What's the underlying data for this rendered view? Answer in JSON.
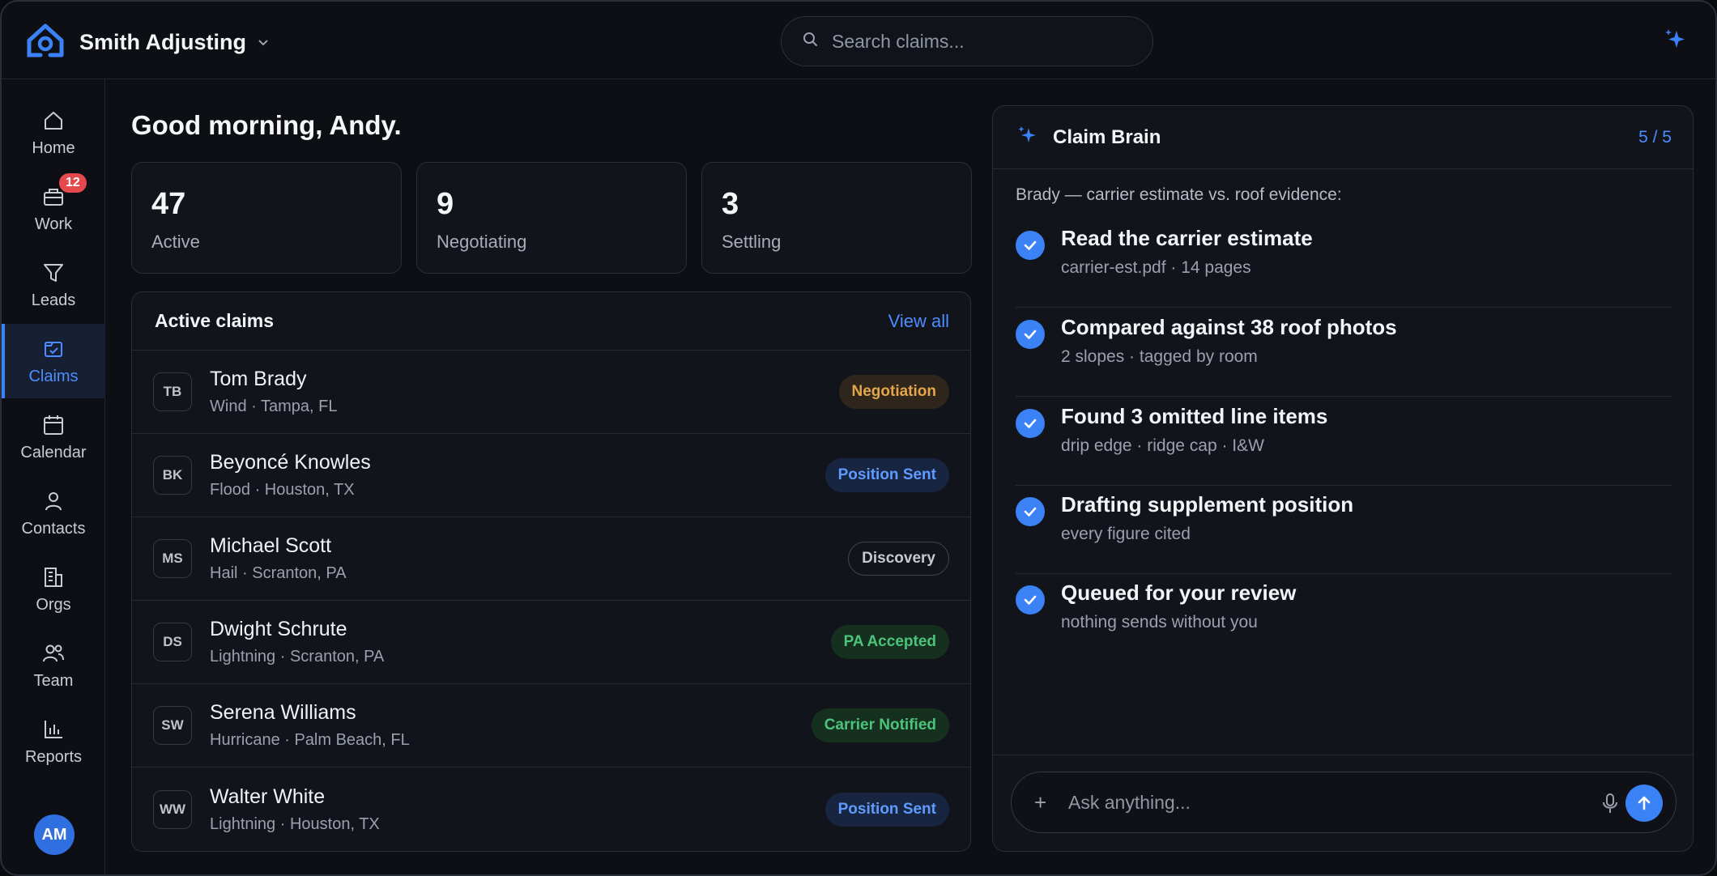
{
  "app": {
    "brand_name": "Smith Adjusting",
    "brand_chevron": "chevron-down-icon"
  },
  "search": {
    "placeholder": "Search claims..."
  },
  "sidebar": {
    "items": [
      {
        "label": "Home",
        "icon": "home-icon"
      },
      {
        "label": "Work",
        "icon": "inbox-icon",
        "badge": "12"
      },
      {
        "label": "Leads",
        "icon": "filter-icon"
      },
      {
        "label": "Claims",
        "icon": "claims-icon",
        "active": true
      },
      {
        "label": "Calendar",
        "icon": "calendar-icon"
      },
      {
        "label": "Contacts",
        "icon": "person-icon"
      },
      {
        "label": "Orgs",
        "icon": "building-icon"
      },
      {
        "label": "Team",
        "icon": "team-icon"
      },
      {
        "label": "Reports",
        "icon": "bar-chart-icon"
      }
    ],
    "avatar": "AM"
  },
  "main": {
    "greeting": "Good morning, Andy.",
    "stats": [
      {
        "value": "47",
        "label": "Active"
      },
      {
        "value": "9",
        "label": "Negotiating"
      },
      {
        "value": "3",
        "label": "Settling"
      }
    ],
    "claims": {
      "title": "Active claims",
      "view_all": "View all",
      "rows": [
        {
          "initials": "TB",
          "name": "Tom Brady",
          "sub": "Wind · Tampa, FL",
          "status": "Negotiation"
        },
        {
          "initials": "BK",
          "name": "Beyoncé Knowles",
          "sub": "Flood · Houston, TX",
          "status": "Position Sent"
        },
        {
          "initials": "MS",
          "name": "Michael Scott",
          "sub": "Hail · Scranton, PA",
          "status": "Discovery"
        },
        {
          "initials": "DS",
          "name": "Dwight Schrute",
          "sub": "Lightning · Scranton, PA",
          "status": "PA Accepted"
        },
        {
          "initials": "SW",
          "name": "Serena Williams",
          "sub": "Hurricane · Palm Beach, FL",
          "status": "Carrier Notified"
        },
        {
          "initials": "WW",
          "name": "Walter White",
          "sub": "Lightning · Houston, TX",
          "status": "Position Sent"
        }
      ]
    }
  },
  "brain": {
    "title": "Claim Brain",
    "count": "5 / 5",
    "intro": "Brady — carrier estimate vs. roof evidence:",
    "steps": [
      {
        "title": "Read the carrier estimate",
        "sub": "carrier-est.pdf · 14 pages"
      },
      {
        "title": "Compared against 38 roof photos",
        "sub": "2 slopes · tagged by room"
      },
      {
        "title": "Found 3 omitted line items",
        "sub": "drip edge · ridge cap · I&W"
      },
      {
        "title": "Drafting supplement position",
        "sub": "every figure cited"
      },
      {
        "title": "Queued for your review",
        "sub": "nothing sends without you"
      }
    ],
    "composer": {
      "plus": "+",
      "placeholder": "Ask anything..."
    }
  },
  "colors": {
    "accent": "#3b82f6",
    "background": "#0d0f14",
    "panel": "#12141b",
    "badge": "#e5484d"
  }
}
